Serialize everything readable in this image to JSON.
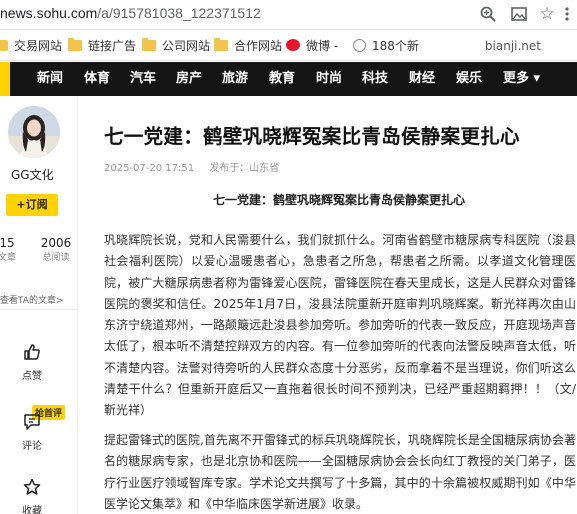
{
  "browser": {
    "url_prefix": "news.sohu.com",
    "url_path": "/a/915781038_122371512",
    "icons": [
      "zoom-icon",
      "image-icon",
      "star-icon",
      "more-icon"
    ]
  },
  "bookmarks": {
    "items": [
      {
        "label": "交易网站",
        "icon": "folder-icon"
      },
      {
        "label": "链接广告",
        "icon": "folder-icon"
      },
      {
        "label": "公司网站",
        "icon": "folder-icon"
      },
      {
        "label": "合作网站",
        "icon": "folder-icon"
      },
      {
        "label": "微博 -",
        "icon": "weibo-icon"
      },
      {
        "label": "188个新",
        "icon": "globe-icon"
      }
    ],
    "right_label": "bianji.net"
  },
  "nav": {
    "items": [
      "新闻",
      "体育",
      "汽车",
      "房产",
      "旅游",
      "教育",
      "时尚",
      "科技",
      "财经",
      "娱乐",
      "更多 ▾"
    ]
  },
  "sidebar": {
    "author_name": "GG文化",
    "subscribe_label": "+订阅",
    "stats": [
      {
        "value": "15",
        "label": "文章"
      },
      {
        "value": "2006",
        "label": "总阅读"
      }
    ],
    "view_more": "查看TA的文章>",
    "actions": [
      {
        "label": "点赞",
        "icon": "thumbs-up-icon"
      },
      {
        "label": "评论",
        "icon": "comment-icon",
        "badge": "抢首评"
      },
      {
        "label": "收藏",
        "icon": "star-icon"
      }
    ]
  },
  "article": {
    "title": "七一党建：鹤壁巩晓辉冤案比青岛侯静案更扎心",
    "date": "2025-07-20 17:51",
    "location": "发布于：山东省",
    "subtitle": "七一党建：鹤壁巩晓辉冤案比青岛侯静案更扎心",
    "paragraphs": [
      "巩晓辉院长说，党和人民需要什么，我们就抓什么。河南省鹤壁市糖尿病专科医院（浚县社会福利医院）以爱心温暖患者心，急患者之所急，帮患者之所需。以孝道文化管理医院，被广大糖尿病患者称为雷锋爱心医院，雷锋医院在春天里成长，这是人民群众对雷锋医院的褒奖和信任。2025年1月7日，浚县法院重新开庭审判巩晓辉案。靳光祥再次由山东济宁绕道郑州，一路颠簸远赴浚县参加旁听。参加旁听的代表一致反应，开庭现场声音太低了，根本听不清楚控辩双方的内容。有一位参加旁听的代表向法警反映声音太低，听不清楚内容。法警对待旁听的人民群众态度十分恶劣，反而拿着不是当理说，你们听这么清楚干什么？但重新开庭后又一直拖着很长时间不预判决，已经严重超期羁押！！（文/靳光祥）",
      "提起雷锋式的医院,首先离不开雷锋式的标兵巩晓辉院长，巩晓辉院长是全国糖尿病协会著名的糖尿病专家，也是北京协和医院——全国糖尿病协会会长向红丁教授的关门弟子，医疗行业医疗领域智库专家。学术论文共撰写了十多篇，其中的十余篇被权威期刊如《中华医学论文集萃》和《中华临床医学新进展》收录。"
    ]
  }
}
